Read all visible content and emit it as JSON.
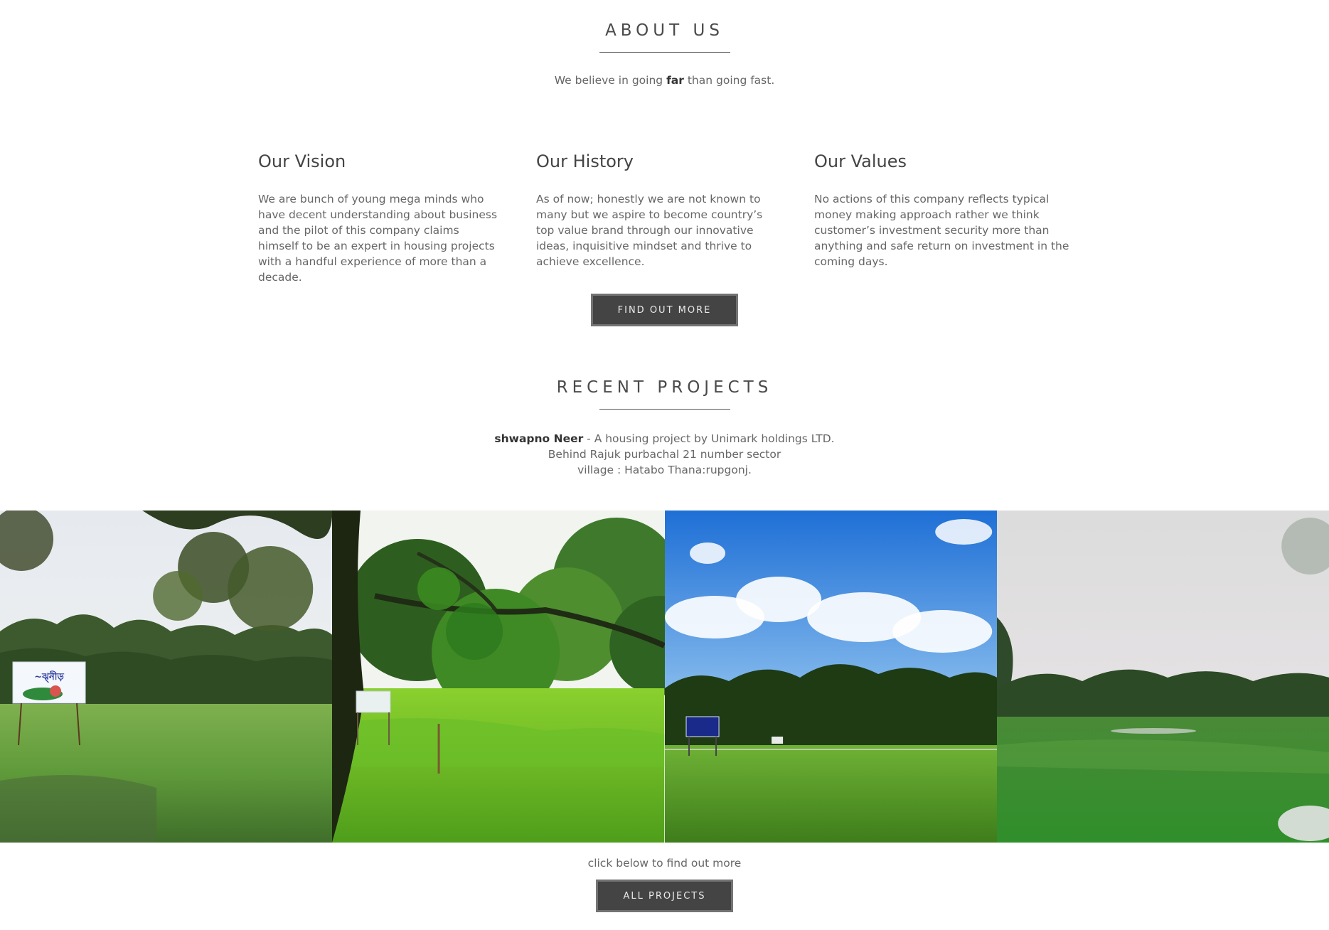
{
  "about": {
    "title": "ABOUT US",
    "tagline_pre": "We believe in going ",
    "tagline_bold": "far",
    "tagline_post": " than going fast."
  },
  "columns": [
    {
      "heading": "Our Vision",
      "body": "We are bunch of young mega minds who have decent understanding about business and the pilot of this company claims himself to be an expert in housing projects with a handful experience of more than a decade."
    },
    {
      "heading": "Our History",
      "body": "As of now; honestly we are not known to many but we aspire to become country’s top value brand through our innovative ideas, inquisitive mindset and thrive to achieve excellence."
    },
    {
      "heading": "Our Values",
      "body": "No actions of this company reflects typical money making approach rather we think customer’s investment security more than anything and safe return on investment in the coming days."
    }
  ],
  "find_out_more": "FIND OUT MORE",
  "projects": {
    "title": "RECENT PROJECTS",
    "name": "shwapno Neer",
    "line1_rest": " - A housing project by Unimark holdings LTD.",
    "line2": "Behind Rajuk purbachal 21 number sector",
    "line3": "village : Hatabo Thana:rupgonj."
  },
  "gallery": [
    {
      "name": "project-photo-field-with-signboard"
    },
    {
      "name": "project-photo-trees-and-signboard"
    },
    {
      "name": "project-photo-blue-sky-field"
    },
    {
      "name": "project-photo-open-green-field"
    }
  ],
  "footer": {
    "note": "click below to find out more",
    "button": "ALL PROJECTS"
  }
}
